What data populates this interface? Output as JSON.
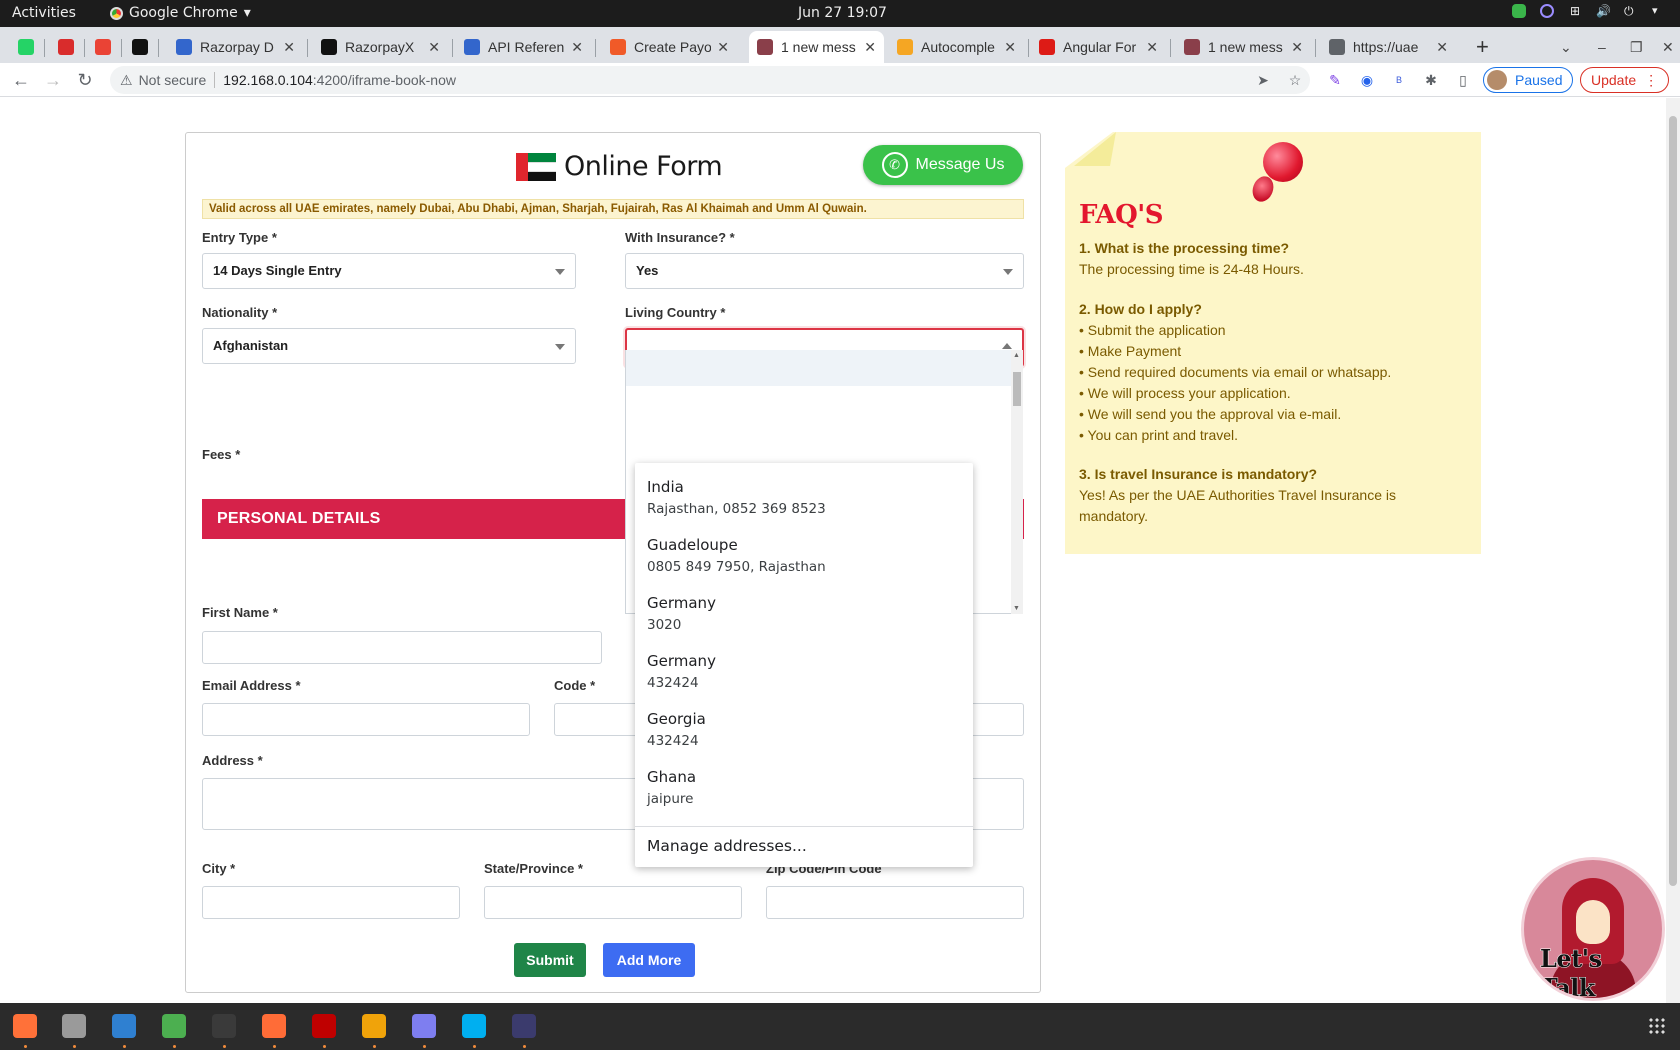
{
  "system": {
    "activities_label": "Activities",
    "app_name": "Google Chrome",
    "clock": "Jun 27  19:07"
  },
  "browser": {
    "tabs": [
      {
        "label": "",
        "favicon_color": "#25d366"
      },
      {
        "label": "",
        "favicon_color": "#d92c2c"
      },
      {
        "label": "",
        "favicon_color": "#ea4335"
      },
      {
        "label": "",
        "favicon_color": "#111111"
      },
      {
        "label": "Razorpay D",
        "favicon_color": "#3366cc"
      },
      {
        "label": "RazorpayX",
        "favicon_color": "#111111"
      },
      {
        "label": "API Referen",
        "favicon_color": "#3366cc"
      },
      {
        "label": "Create Payo",
        "favicon_color": "#f05a28"
      },
      {
        "label": "1 new mess",
        "favicon_color": "#8a3f4a",
        "active": true
      },
      {
        "label": "Autocomple",
        "favicon_color": "#f5a623"
      },
      {
        "label": "Angular For",
        "favicon_color": "#dd1b16"
      },
      {
        "label": "1 new mess",
        "favicon_color": "#8a3f4a"
      },
      {
        "label": "https://uae",
        "favicon_color": "#5f6368"
      }
    ],
    "new_tab_label": "+",
    "address": {
      "security_label": "Not secure",
      "host": "192.168.0.104",
      "path": ":4200/iframe-book-now"
    },
    "profile_label": "Paused",
    "update_label": "Update"
  },
  "form": {
    "title": "Online Form",
    "message_us_label": "Message Us",
    "notice": "Valid across all UAE emirates, namely Dubai, Abu Dhabi, Ajman, Sharjah, Fujairah, Ras Al Khaimah and Umm Al Quwain.",
    "entry_type": {
      "label": "Entry Type *",
      "value": "14 Days Single Entry"
    },
    "insurance": {
      "label": "With Insurance? *",
      "value": "Yes"
    },
    "nationality": {
      "label": "Nationality *",
      "value": "Afghanistan"
    },
    "living_country": {
      "label": "Living Country *",
      "value": ""
    },
    "fees_label": "Fees *",
    "personal_details_header": "PERSONAL DETAILS",
    "first_name_label": "First Name *",
    "email_label": "Email Address *",
    "code_label": "Code *",
    "address_label": "Address *",
    "city_label": "City *",
    "state_label": "State/Province *",
    "zip_label": "Zip Code/Pin Code",
    "submit_label": "Submit",
    "add_more_label": "Add More"
  },
  "autofill": {
    "items": [
      {
        "main": "India",
        "sub": "Rajasthan, 0852 369 8523"
      },
      {
        "main": "Guadeloupe",
        "sub": "0805 849 7950, Rajasthan"
      },
      {
        "main": "Germany",
        "sub": "3020"
      },
      {
        "main": "Germany",
        "sub": "432424"
      },
      {
        "main": "Georgia",
        "sub": "432424"
      },
      {
        "main": "Ghana",
        "sub": "jaipure"
      }
    ],
    "manage_label": "Manage addresses..."
  },
  "faq": {
    "title": "FAQ'S",
    "q1": "1. What is the processing time?",
    "a1": "The processing time is 24-48 Hours.",
    "q2": "2. How do I apply?",
    "a2_items": [
      "• Submit the application",
      "• Make Payment",
      "• Send required documents via email or whatsapp.",
      "• We will process your application.",
      "• We will send you the approval via e-mail.",
      "• You can print and travel."
    ],
    "q3": "3. Is travel Insurance is mandatory?",
    "a3": "Yes! As per the UAE Authorities Travel Insurance is mandatory."
  },
  "chat_widget": {
    "label": "Let's Talk"
  },
  "taskbar": {
    "apps": [
      {
        "name": "firefox-icon",
        "color": "#ff7139"
      },
      {
        "name": "files-icon",
        "color": "#9a9a9a"
      },
      {
        "name": "vscode-icon",
        "color": "#2f80d1"
      },
      {
        "name": "chrome-icon",
        "color": "#4caf50"
      },
      {
        "name": "terminal-icon",
        "color": "#3a3a3a"
      },
      {
        "name": "postman-icon",
        "color": "#ff6c37"
      },
      {
        "name": "filezilla-icon",
        "color": "#bf0000"
      },
      {
        "name": "calculator-icon",
        "color": "#f0a30a"
      },
      {
        "name": "timer-icon",
        "color": "#7e7ef0"
      },
      {
        "name": "skype-icon",
        "color": "#00aff0"
      },
      {
        "name": "cloud-app-icon",
        "color": "#3b3b6d"
      }
    ]
  }
}
